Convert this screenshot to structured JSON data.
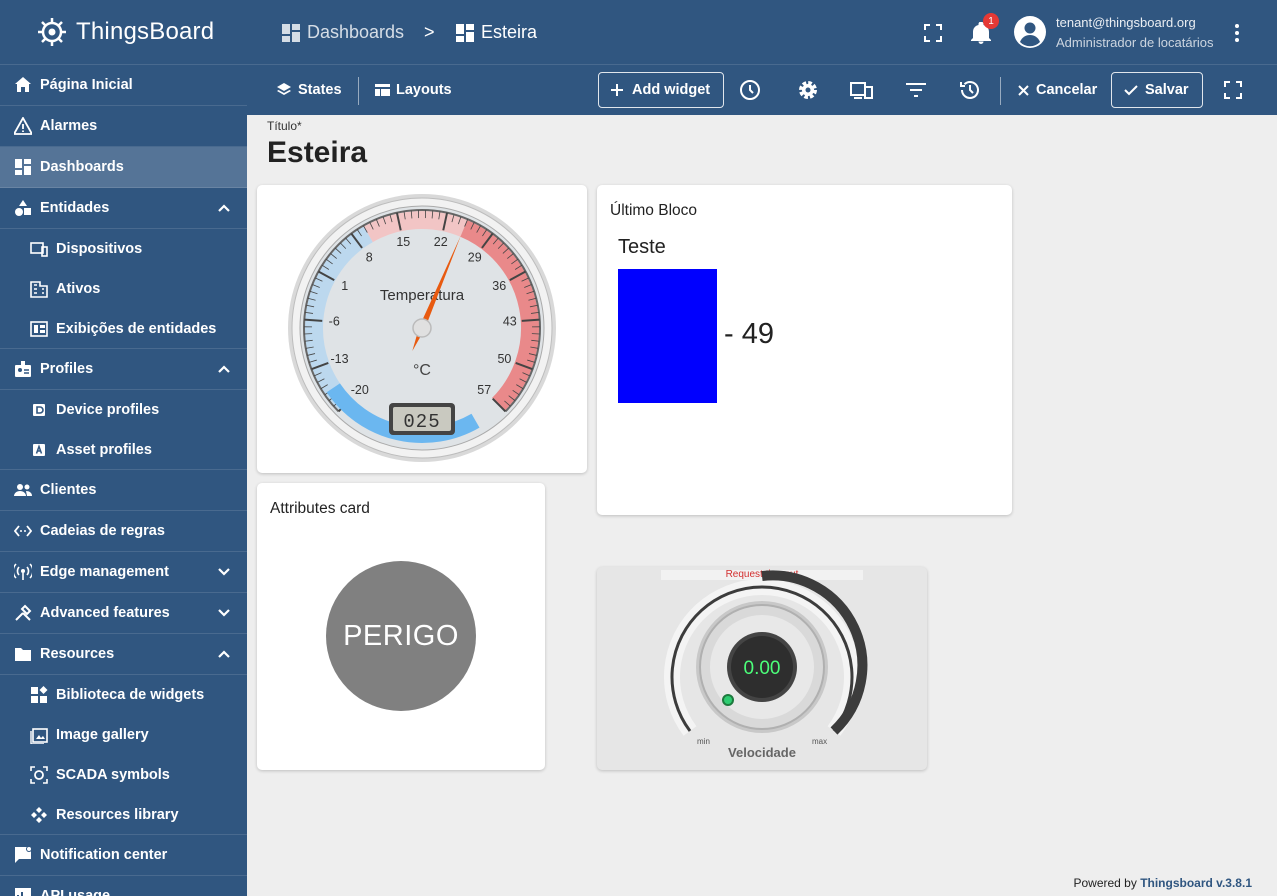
{
  "app": {
    "name": "ThingsBoard"
  },
  "sidebar": {
    "items": [
      {
        "label": "Página Inicial",
        "icon": "home-icon"
      },
      {
        "label": "Alarmes",
        "icon": "warning-icon"
      },
      {
        "label": "Dashboards",
        "icon": "dashboard-icon",
        "active": true
      },
      {
        "label": "Entidades",
        "icon": "shapes-icon",
        "expanded": true
      },
      {
        "label": "Dispositivos",
        "icon": "devices-icon",
        "sub": true
      },
      {
        "label": "Ativos",
        "icon": "building-icon",
        "sub": true
      },
      {
        "label": "Exibições de entidades",
        "icon": "view-icon",
        "sub": true
      },
      {
        "label": "Profiles",
        "icon": "badge-icon",
        "expanded": true
      },
      {
        "label": "Device profiles",
        "icon": "device-profile-icon",
        "sub": true
      },
      {
        "label": "Asset profiles",
        "icon": "asset-profile-icon",
        "sub": true
      },
      {
        "label": "Clientes",
        "icon": "people-icon"
      },
      {
        "label": "Cadeias de regras",
        "icon": "code-icon"
      },
      {
        "label": "Edge management",
        "icon": "antenna-icon",
        "expanded": false
      },
      {
        "label": "Advanced features",
        "icon": "tools-icon",
        "expanded": false
      },
      {
        "label": "Resources",
        "icon": "folder-icon",
        "expanded": true
      },
      {
        "label": "Biblioteca de widgets",
        "icon": "widgets-icon",
        "sub": true
      },
      {
        "label": "Image gallery",
        "icon": "image-icon",
        "sub": true
      },
      {
        "label": "SCADA symbols",
        "icon": "scada-icon",
        "sub": true
      },
      {
        "label": "Resources library",
        "icon": "library-icon",
        "sub": true
      },
      {
        "label": "Notification center",
        "icon": "notification-icon"
      },
      {
        "label": "API usage",
        "icon": "api-icon"
      }
    ]
  },
  "header": {
    "breadcrumb": [
      "Dashboards",
      "Esteira"
    ],
    "breadcrumb_sep": ">",
    "notification_count": "1",
    "user_email": "tenant@thingsboard.org",
    "user_role": "Administrador de locatários"
  },
  "toolbar": {
    "states": "States",
    "layouts": "Layouts",
    "add_widget": "Add widget",
    "cancel": "Cancelar",
    "save": "Salvar"
  },
  "dashboard": {
    "title_label": "Título",
    "title_required": "*",
    "title_value": "Esteira"
  },
  "widgets": {
    "gauge": {
      "label": "Temperatura",
      "unit": "°C",
      "ticks": [
        "-20",
        "-13",
        "-6",
        "1",
        "8",
        "15",
        "22",
        "29",
        "36",
        "43",
        "50",
        "57"
      ],
      "display": "025",
      "min": -20,
      "max": 57,
      "value": 25
    },
    "last_block": {
      "title": "Último Bloco",
      "name": "Teste",
      "value": "- 49",
      "color": "#0000ff"
    },
    "attributes": {
      "title": "Attributes card",
      "status": "PERIGO",
      "circle_color": "#808080"
    },
    "knob": {
      "error": "Request timeout",
      "value": "0.00",
      "min_label": "min",
      "max_label": "max",
      "label": "Velocidade"
    }
  },
  "footer": {
    "powered_by": "Powered by",
    "brand": "Thingsboard v.3.8.1"
  }
}
